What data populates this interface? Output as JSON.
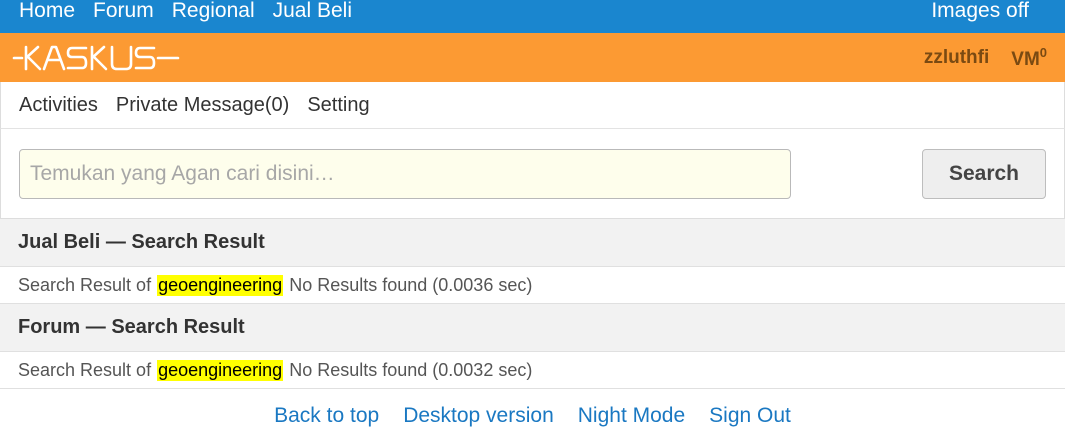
{
  "topnav": {
    "links": [
      "Home",
      "Forum",
      "Regional",
      "Jual Beli"
    ],
    "right": "Images off"
  },
  "brand": {
    "logo_text": "KASKUS",
    "username": "zzluthfi",
    "vm_label": "VM",
    "vm_count": "0"
  },
  "subnav": {
    "items": [
      "Activities",
      "Private Message(0)",
      "Setting"
    ]
  },
  "search": {
    "placeholder": "Temukan yang Agan cari disini…",
    "value": "",
    "button_label": "Search"
  },
  "results": [
    {
      "title": "Jual Beli — Search Result",
      "prefix": "Search Result of",
      "query": "geoengineering",
      "suffix": "No Results found (0.0036 sec)"
    },
    {
      "title": "Forum — Search Result",
      "prefix": "Search Result of",
      "query": "geoengineering",
      "suffix": "No Results found (0.0032 sec)"
    }
  ],
  "footer": {
    "links": [
      "Back to top",
      "Desktop version",
      "Night Mode",
      "Sign Out"
    ]
  },
  "colors": {
    "topnav_bg": "#1a86cf",
    "brand_bg": "#fc9a33",
    "highlight": "#ffff00",
    "footer_link": "#1a78c2"
  }
}
